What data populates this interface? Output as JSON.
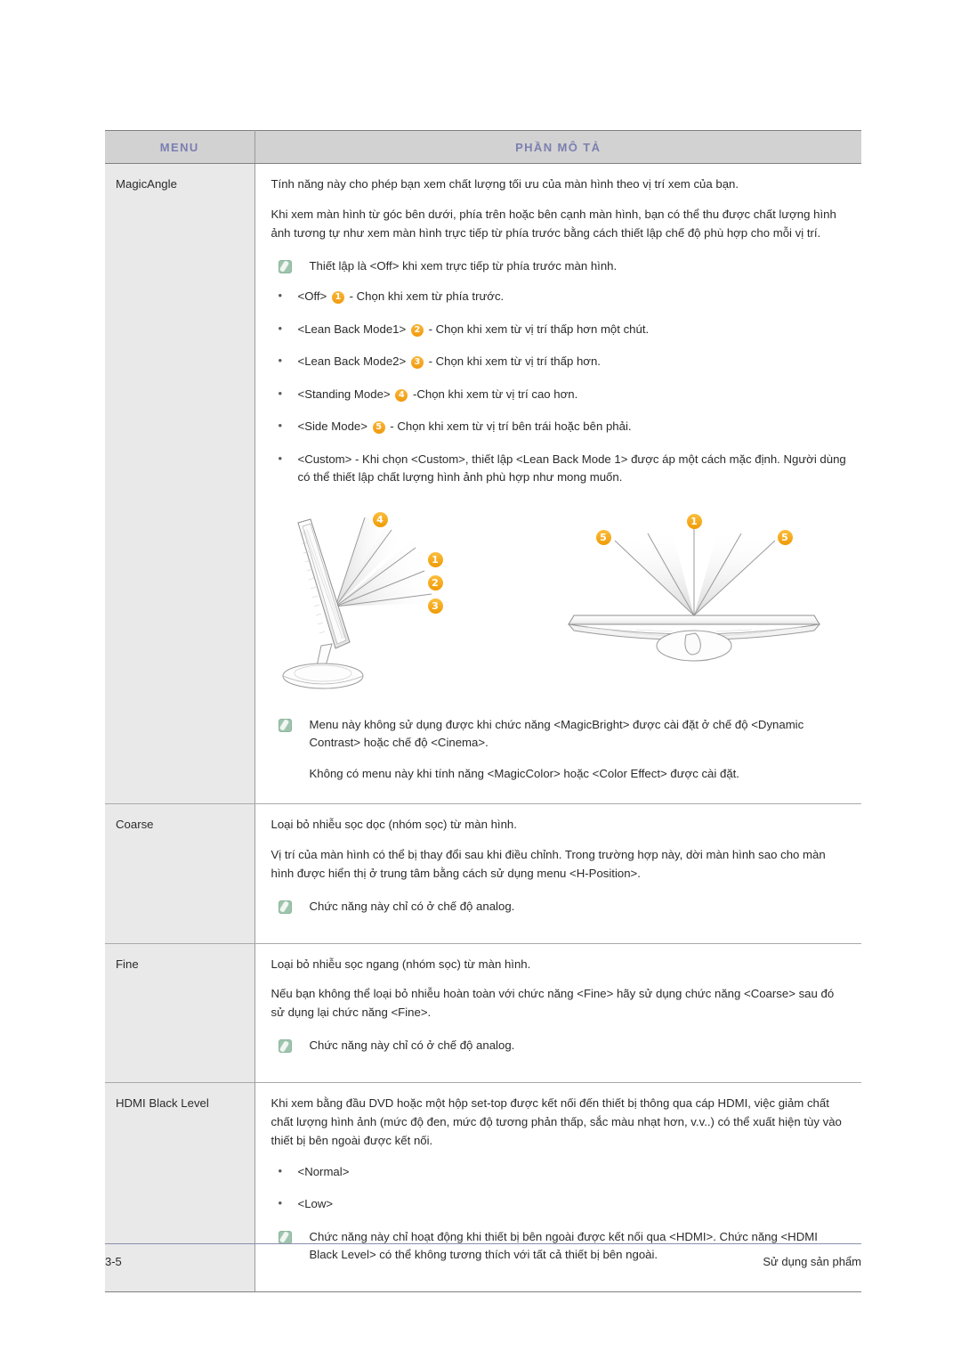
{
  "document": {
    "page_label": "3-5",
    "footer_right": "Sử dụng sản phẩm"
  },
  "table": {
    "headers": {
      "menu": "MENU",
      "description": "PHẦN MÔ TẢ"
    },
    "header_text_color": "#7b7fb0",
    "header_bg_color": "#d2d2d2",
    "menu_cell_bg_color": "#e9e9e9",
    "badge_color": "#f5a623",
    "note_icon_color": "#9ec4ad",
    "rows": [
      {
        "menu": "MagicAngle",
        "paragraphs": [
          "Tính năng này cho phép bạn xem chất lượng tối ưu của màn hình theo vị trí xem của bạn.",
          "Khi xem màn hình từ góc bên dưới, phía trên hoặc bên cạnh màn hình, bạn có thể thu được chất lượng hình ảnh tương tự như xem màn hình trực tiếp từ phía trước bằng cách thiết lập chế độ phù hợp cho mỗi vị trí."
        ],
        "note_top": "Thiết lập là <Off> khi xem trực tiếp từ phía trước màn hình.",
        "bullets": [
          {
            "pre": "<Off>",
            "badge": "1",
            "post": "- Chọn khi xem từ phía trước."
          },
          {
            "pre": "<Lean Back Mode1>",
            "badge": "2",
            "post": "- Chọn khi xem từ vị trí thấp hơn một chút."
          },
          {
            "pre": "<Lean Back Mode2>",
            "badge": "3",
            "post": "- Chọn khi xem từ vị trí thấp hơn."
          },
          {
            "pre": "<Standing Mode>",
            "badge": "4",
            "post": "-Chọn khi xem từ vị trí cao hơn."
          },
          {
            "pre": "<Side Mode>",
            "badge": "5",
            "post": "- Chọn khi xem từ vị trí bên trái hoặc bên phải."
          },
          {
            "pre": "<Custom> - Khi chọn <Custom>, thiết lập <Lean Back Mode 1> được áp một cách mặc định. Người dùng có thể thiết lập chất lượng hình ảnh phù hợp như mong muốn.",
            "badge": "",
            "post": ""
          }
        ],
        "figure": {
          "left_view_badges": [
            "4",
            "1",
            "2",
            "3"
          ],
          "right_view_badges": [
            "5",
            "1",
            "5"
          ],
          "caption": ""
        },
        "note_bottom": "Menu này không sử dụng được khi chức năng <MagicBright> được cài đặt ở chế độ <Dynamic Contrast> hoặc chế độ <Cinema>.",
        "note_bottom_sub": "Không có menu này khi tính năng <MagicColor> hoặc <Color Effect> được cài đặt."
      },
      {
        "menu": "Coarse",
        "paragraphs": [
          "Loại bỏ nhiễu sọc dọc (nhóm sọc) từ màn hình.",
          "Vị trí của màn hình có thể bị thay đổi sau khi điều chỉnh. Trong trường hợp này, dời màn hình sao cho màn hình được hiển thị ở trung tâm bằng cách sử dụng menu <H-Position>."
        ],
        "note_bottom": "Chức năng này chỉ có ở chế độ analog."
      },
      {
        "menu": "Fine",
        "paragraphs": [
          "Loại bỏ nhiễu sọc ngang (nhóm sọc) từ màn hình.",
          "Nếu bạn không thể loại bỏ nhiễu hoàn toàn với chức năng <Fine> hãy sử dụng chức năng <Coarse> sau đó sử dụng lại chức năng <Fine>."
        ],
        "note_bottom": "Chức năng này chỉ có ở chế độ analog."
      },
      {
        "menu": "HDMI Black Level",
        "paragraphs": [
          "Khi xem bằng đầu DVD hoặc một hộp set-top được kết nối đến thiết bị thông qua cáp HDMI, việc giảm chất chất lượng hình ảnh (mức độ đen, mức độ tương phản thấp, sắc màu nhạt hơn, v.v..) có thể xuất hiện tùy vào thiết bị bên ngoài được kết nối."
        ],
        "options": [
          "<Normal>",
          "<Low>"
        ],
        "note_bottom": "Chức năng này chỉ hoạt động khi thiết bị bên ngoài được kết nối qua <HDMI>. Chức năng <HDMI Black Level> có thể không tương thích với tất cả thiết bị bên ngoài."
      }
    ]
  }
}
